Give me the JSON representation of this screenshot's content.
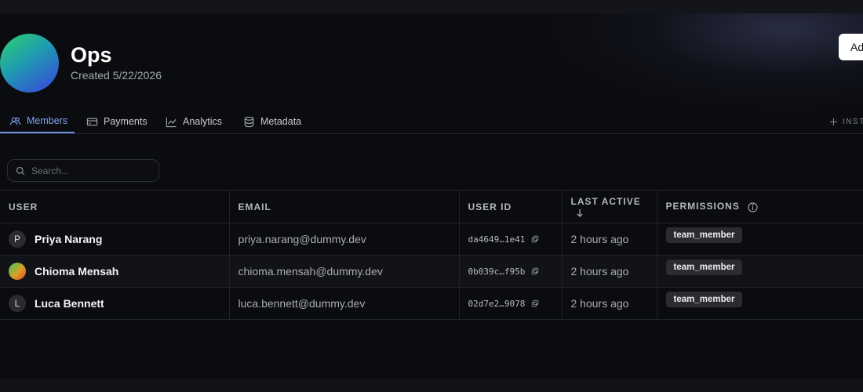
{
  "org": {
    "name": "Ops",
    "created": "Created 5/22/2026"
  },
  "header": {
    "add_button_label": "Ad"
  },
  "tabs": [
    {
      "label": "Members",
      "icon": "users-icon",
      "active": true
    },
    {
      "label": "Payments",
      "icon": "credit-card-icon",
      "active": false
    },
    {
      "label": "Analytics",
      "icon": "chart-line-icon",
      "active": false
    },
    {
      "label": "Metadata",
      "icon": "database-icon",
      "active": false
    }
  ],
  "install_label": "INST",
  "search": {
    "placeholder": "Search..."
  },
  "table": {
    "columns": {
      "user": "USER",
      "email": "EMAIL",
      "user_id": "USER ID",
      "last_active": "LAST ACTIVE",
      "permissions": "PERMISSIONS"
    },
    "rows": [
      {
        "initial": "P",
        "name": "Priya Narang",
        "email": "priya.narang@dummy.dev",
        "user_id": "da4649…1e41",
        "last_active": "2 hours ago",
        "permission": "team_member"
      },
      {
        "initial": "",
        "name": "Chioma Mensah",
        "email": "chioma.mensah@dummy.dev",
        "user_id": "0b039c…f95b",
        "last_active": "2 hours ago",
        "permission": "team_member"
      },
      {
        "initial": "L",
        "name": "Luca Bennett",
        "email": "luca.bennett@dummy.dev",
        "user_id": "02d7e2…9078",
        "last_active": "2 hours ago",
        "permission": "team_member"
      }
    ]
  },
  "colors": {
    "background": "#0b0c0f",
    "accent": "#7fa2f0",
    "badge": "#2a2c31"
  }
}
